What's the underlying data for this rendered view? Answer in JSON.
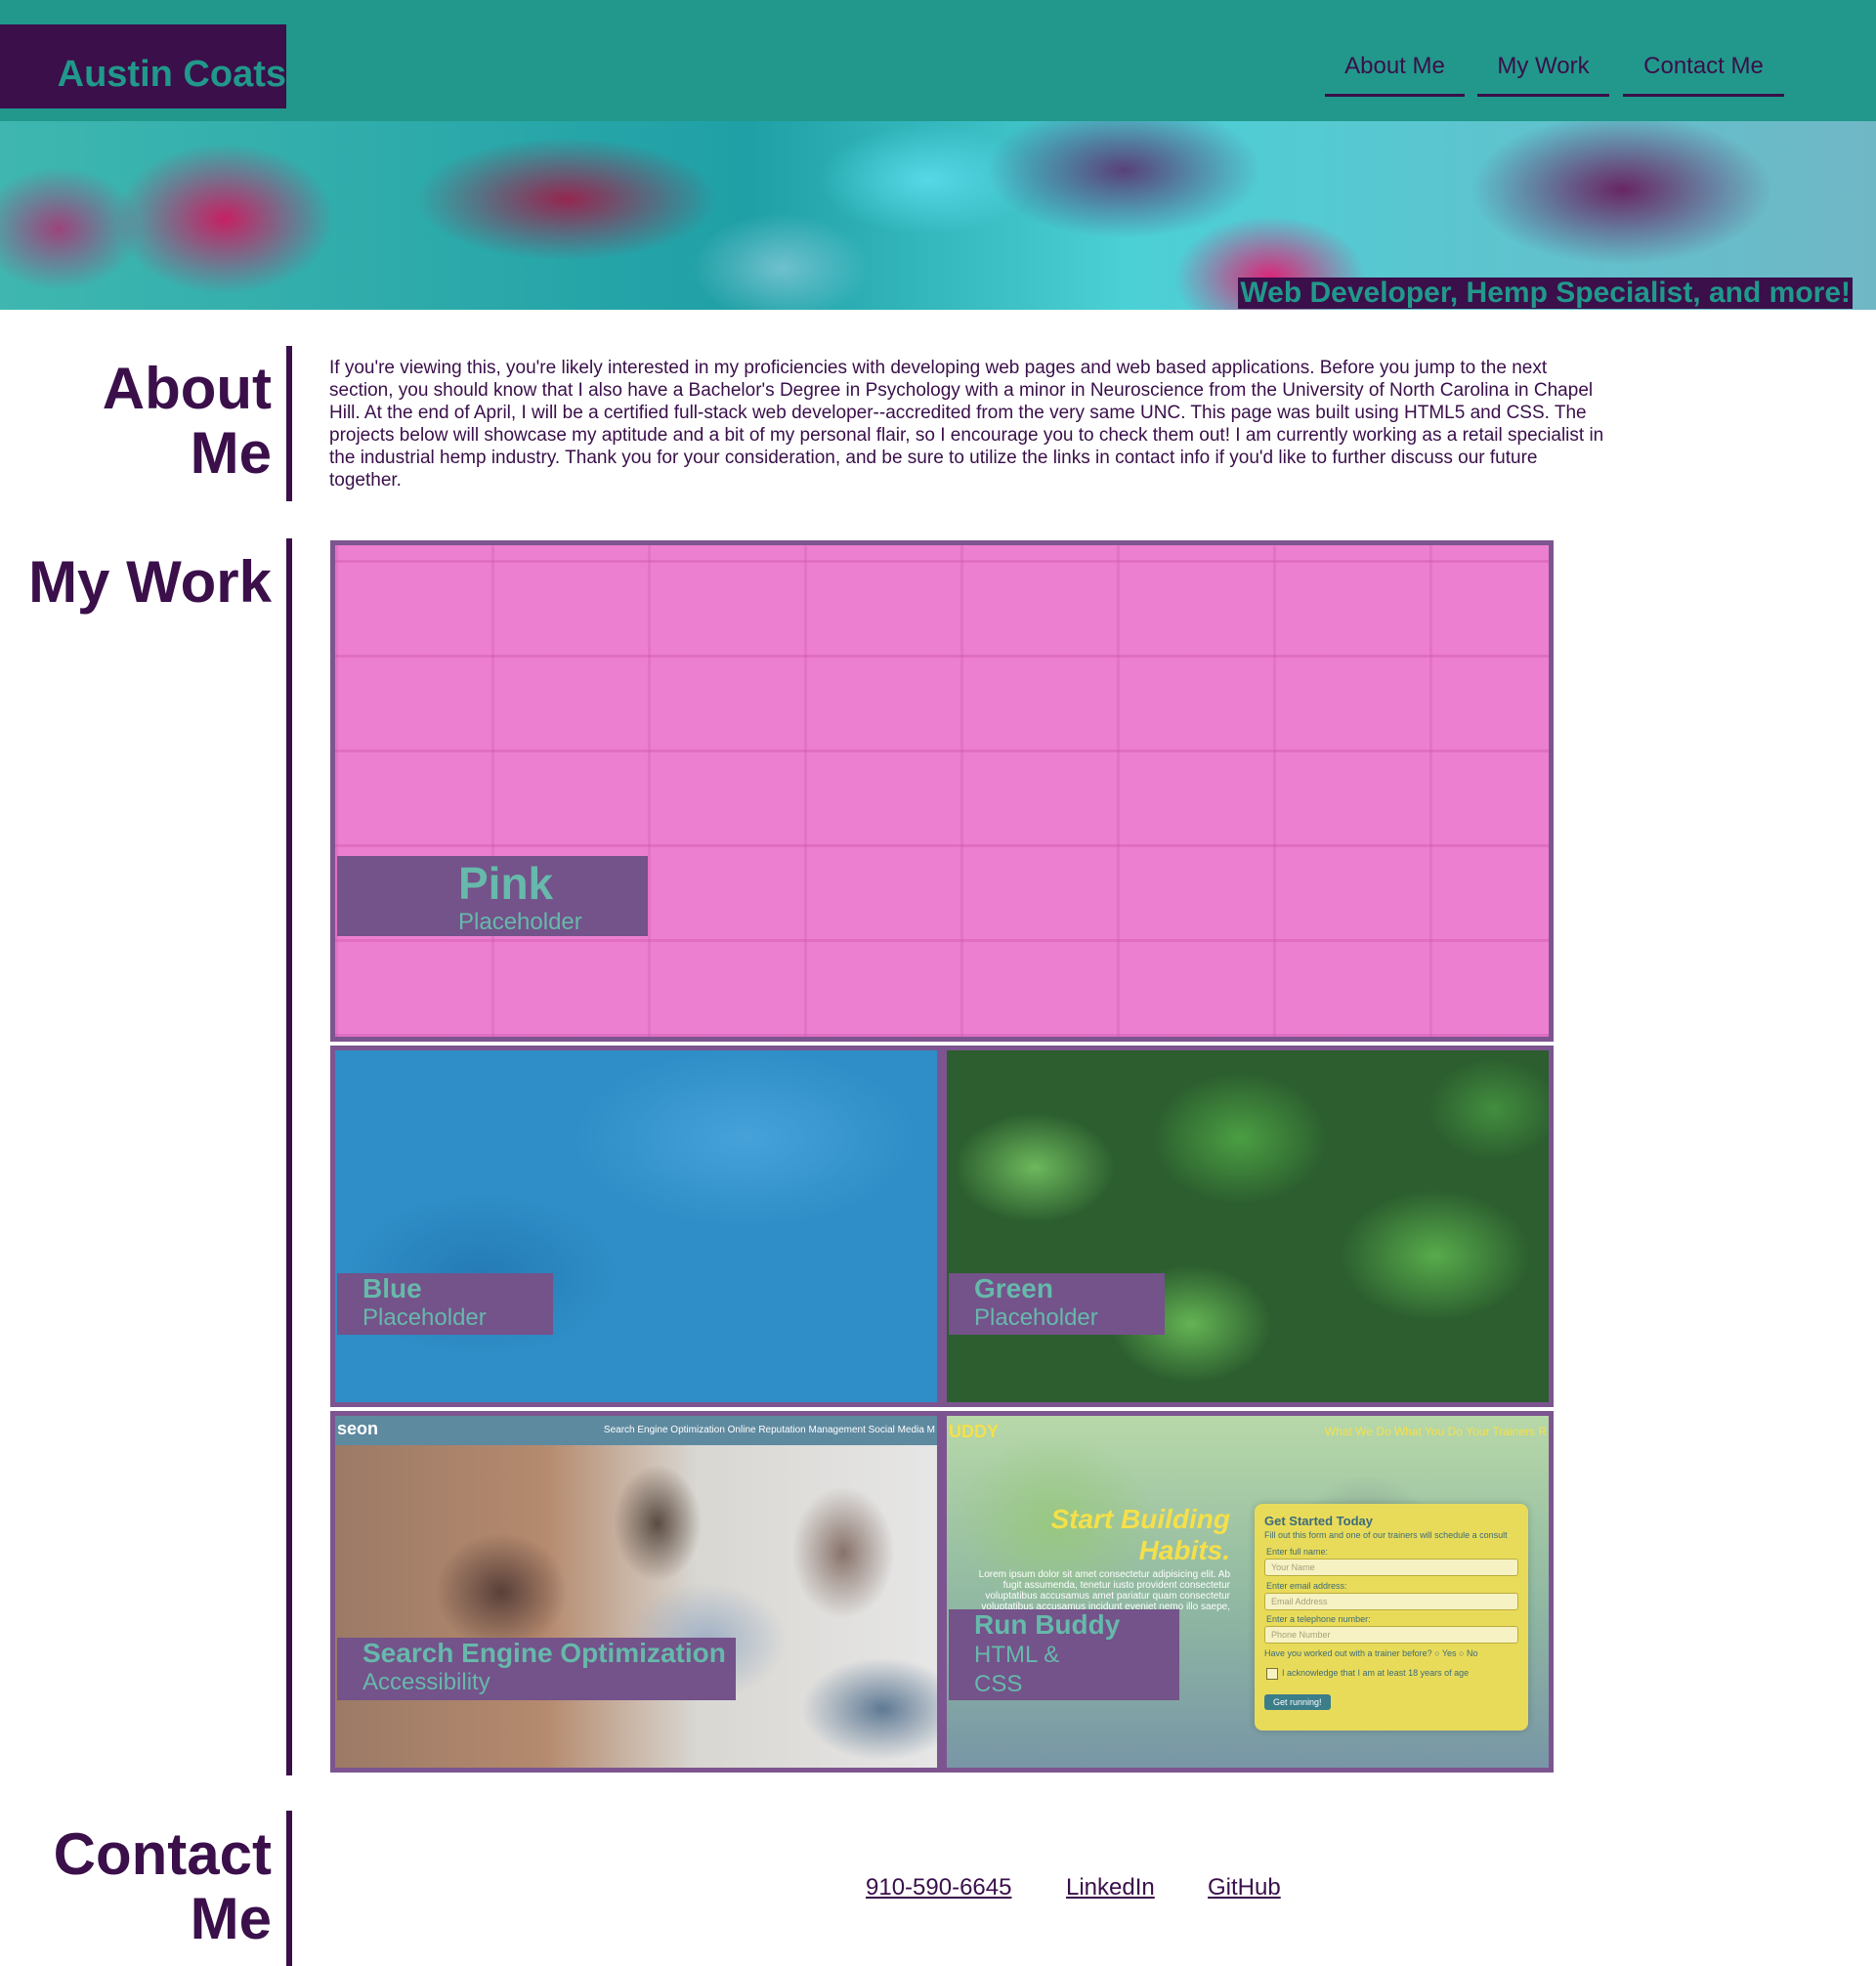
{
  "header": {
    "logo_text": "Austin Coats",
    "nav": [
      "About Me",
      "My Work",
      "Contact Me"
    ]
  },
  "hero": {
    "tagline": "Web Developer, Hemp Specialist, and more!"
  },
  "about": {
    "title": "About Me",
    "body": "If you're viewing this, you're likely interested in my proficiencies with developing web pages and web based applications. Before you jump to the next section, you should know that I also have a Bachelor's Degree in Psychology with a minor in Neuroscience from the University of North Carolina in Chapel Hill. At the end of April, I will be a certified full-stack web developer--accredited from the very same UNC. This page was built using HTML5 and CSS. The projects below will showcase my aptitude and a bit of my personal flair, so I encourage you to check them out! I am currently working as a retail specialist in the industrial hemp industry. Thank you for your consideration, and be sure to utilize the links in contact info if you'd like to further discuss our future together."
  },
  "work": {
    "title": "My Work",
    "projects": [
      {
        "title": "Pink",
        "subtitle": "Placeholder"
      },
      {
        "title": "Blue",
        "subtitle": "Placeholder"
      },
      {
        "title": "Green",
        "subtitle": "Placeholder"
      },
      {
        "title": "Search Engine Optimization",
        "subtitle": "Accessibility",
        "preview": {
          "brand": "seon",
          "menu": "Search Engine Optimization   Online Reputation Management   Social Media M"
        }
      },
      {
        "title": "Run Buddy",
        "subtitle": "HTML & CSS",
        "preview": {
          "brand": "UDDY",
          "menu": "What We Do    What You Do    Your Trainers    R",
          "hero_title": "Start Building Habits.",
          "hero_body": "Lorem ipsum dolor sit amet consectetur adipisicing elit. Ab fugit assumenda, tenetur iusto provident consectetur voluptatibus accusamus amet pariatur quam consectetur voluptatibus accusamus incidunt eveniet nemo illo saepe, expedita voluptatum.",
          "form_title": "Get Started Today",
          "form_sub": "Fill out this form and one of our trainers will schedule a consult",
          "label_name": "Enter full name:",
          "ph_name": "Your Name",
          "label_email": "Enter email address:",
          "ph_email": "Email Address",
          "label_phone": "Enter a telephone number:",
          "ph_phone": "Phone Number",
          "question": "Have you worked out with a trainer before?  ○ Yes ○ No",
          "ack": "I acknowledge that I am at least 18 years of age",
          "button": "Get running!"
        }
      }
    ]
  },
  "contact": {
    "title": "Contact Me",
    "links": [
      "910-590-6645",
      "LinkedIn",
      "GitHub"
    ]
  },
  "colors": {
    "primary_teal": "#21988b",
    "dark_purple": "#3a0f4a",
    "caption_purple": "#74528a",
    "card_border": "#7c5590"
  }
}
